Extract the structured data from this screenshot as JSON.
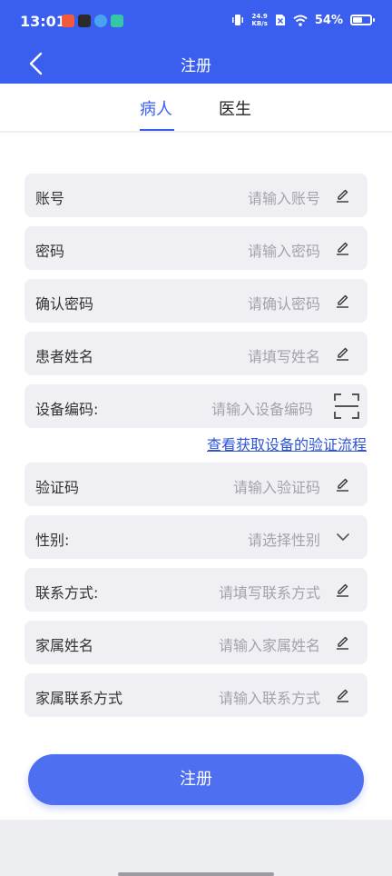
{
  "status_bar": {
    "time": "13:01",
    "network_speed_value": "24.9",
    "network_speed_unit": "KB/s",
    "battery_text": "54%",
    "battery_level": 0.54,
    "notification_colors": [
      "#f15a3c",
      "#2b2b2b",
      "#4aa3f0",
      "#35c6a8"
    ]
  },
  "nav": {
    "title": "注册"
  },
  "tabs": [
    {
      "label": "病人",
      "active": true
    },
    {
      "label": "医生",
      "active": false
    }
  ],
  "form": {
    "fields": [
      {
        "label": "账号",
        "placeholder": "请输入账号",
        "icon": "pencil-icon"
      },
      {
        "label": "密码",
        "placeholder": "请输入密码",
        "icon": "pencil-icon"
      },
      {
        "label": "确认密码",
        "placeholder": "请确认密码",
        "icon": "pencil-icon"
      },
      {
        "label": "患者姓名",
        "placeholder": "请填写姓名",
        "icon": "pencil-icon"
      },
      {
        "label": "设备编码:",
        "placeholder": "请输入设备编码",
        "icon": "scan-icon"
      },
      {
        "label": "验证码",
        "placeholder": "请输入验证码",
        "icon": "pencil-icon"
      },
      {
        "label": "性别:",
        "placeholder": "请选择性别",
        "icon": "chevron-down-icon"
      },
      {
        "label": "联系方式:",
        "placeholder": "请填写联系方式",
        "icon": "pencil-icon"
      },
      {
        "label": "家属姓名",
        "placeholder": "请输入家属姓名",
        "icon": "pencil-icon"
      },
      {
        "label": "家属联系方式",
        "placeholder": "请输入联系方式",
        "icon": "pencil-icon"
      }
    ],
    "verify_link": "查看获取设备的验证流程",
    "submit_label": "注册"
  },
  "colors": {
    "primary": "#3a5fef",
    "button": "#4f6ff1",
    "field_bg": "#efeff4",
    "link": "#2e54d6"
  }
}
